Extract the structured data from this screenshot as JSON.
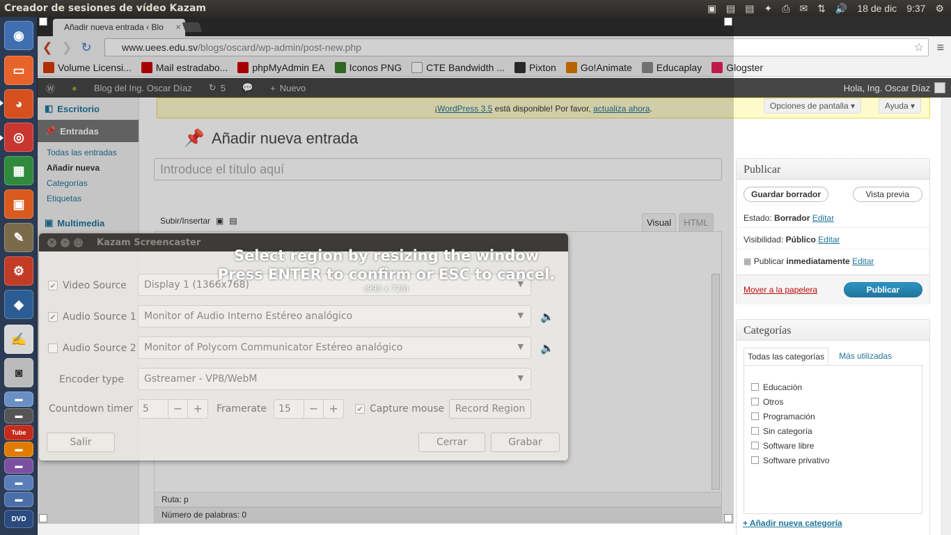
{
  "top_panel": {
    "title": "Creador de sesiones de vídeo Kazam",
    "date": "18 de dic",
    "time": "9:37"
  },
  "launcher": {
    "items": [
      "dash",
      "files",
      "firefox",
      "chrome",
      "spreadsheet",
      "software-center",
      "gimp",
      "settings",
      "virtualbox",
      "text-editor",
      "screenshot",
      "stack-1",
      "stack-2",
      "youtube",
      "stack-3",
      "stack-4",
      "stack-5",
      "stack-6",
      "dvd"
    ]
  },
  "browser": {
    "tab_title": "Añadir nueva entrada ‹ Blo",
    "tab_close": "×",
    "url_host": "www.uees.edu.sv",
    "url_path": "/blogs/oscard/wp-admin/post-new.php",
    "bookmarks": [
      {
        "label": "Volume Licensi...",
        "color": "#d83b01"
      },
      {
        "label": "Mail estradabo...",
        "color": "#cc0000"
      },
      {
        "label": "phpMyAdmin EA",
        "color": "#cc0000"
      },
      {
        "label": "Iconos PNG",
        "color": "#3a7d2c"
      },
      {
        "label": "CTE Bandwidth ...",
        "color": "#cccccc"
      },
      {
        "label": "Pixton",
        "color": "#333333"
      },
      {
        "label": "Go!Animate",
        "color": "#e07b00"
      },
      {
        "label": "Educaplay",
        "color": "#8a8a8a"
      },
      {
        "label": "Glogster",
        "color": "#e8205b"
      }
    ]
  },
  "wp_admin_bar": {
    "site_name": "Blog del Ing. Oscar Díaz",
    "updates_count": "5",
    "new_label": "Nuevo",
    "greeting": "Hola, Ing. Oscar Díaz"
  },
  "wp_sidebar": {
    "escritorio": "Escritorio",
    "entradas": "Entradas",
    "sub_items": [
      "Todas las entradas",
      "Añadir nueva",
      "Categorías",
      "Etiquetas"
    ],
    "multimedia": "Multimedia"
  },
  "wp_main": {
    "notice_link1": "WordPress 3.5",
    "notice_text": " está disponible! Por favor, ",
    "notice_link2": "actualiza ahora",
    "notice_prefix": "¡",
    "screen_options": "Opciones de pantalla",
    "help": "Ayuda",
    "page_title": "Añadir nueva entrada",
    "title_placeholder": "Introduce el título aquí",
    "upload_label": "Subir/Insertar",
    "tab_visual": "Visual",
    "tab_html": "HTML",
    "ruta": "Ruta: p",
    "word_count": "Número de palabras: 0"
  },
  "publish_box": {
    "heading": "Publicar",
    "save_draft": "Guardar borrador",
    "preview": "Vista previa",
    "status_label": "Estado: ",
    "status_value": "Borrador",
    "visibility_label": "Visibilidad: ",
    "visibility_value": "Público",
    "publish_label": "Publicar ",
    "publish_value": "inmediatamente",
    "edit": "Editar",
    "trash": "Mover a la papelera",
    "publish_button": "Publicar"
  },
  "categories_box": {
    "heading": "Categorías",
    "tab_all": "Todas las categorías",
    "tab_popular": "Más utilizadas",
    "items": [
      "Educación",
      "Otros",
      "Programación",
      "Sin categoría",
      "Software libre",
      "Software privativo"
    ],
    "add_new": "+ Añadir nueva categoría"
  },
  "kazam": {
    "title": "Kazam Screencaster",
    "video_source_label": "Video Source",
    "video_source_value": "Display 1 (1366x768)",
    "audio1_label": "Audio Source 1",
    "audio1_value": "Monitor of Audio Interno Estéreo analógico",
    "audio2_label": "Audio Source 2",
    "audio2_value": "Monitor of Polycom Communicator Estéreo analógico",
    "encoder_label": "Encoder type",
    "encoder_value": "Gstreamer - VP8/WebM",
    "countdown_label": "Countdown timer",
    "countdown_value": "5",
    "framerate_label": "Framerate",
    "framerate_value": "15",
    "capture_mouse": "Capture mouse",
    "record_region": "Record Region",
    "quit": "Salir",
    "close": "Cerrar",
    "record": "Grabar",
    "overlay_line1": "Select region by resizing the window",
    "overlay_line2": "Press ENTER to confirm or ESC to cancel.",
    "overlay_size": "(998 x 728)"
  }
}
